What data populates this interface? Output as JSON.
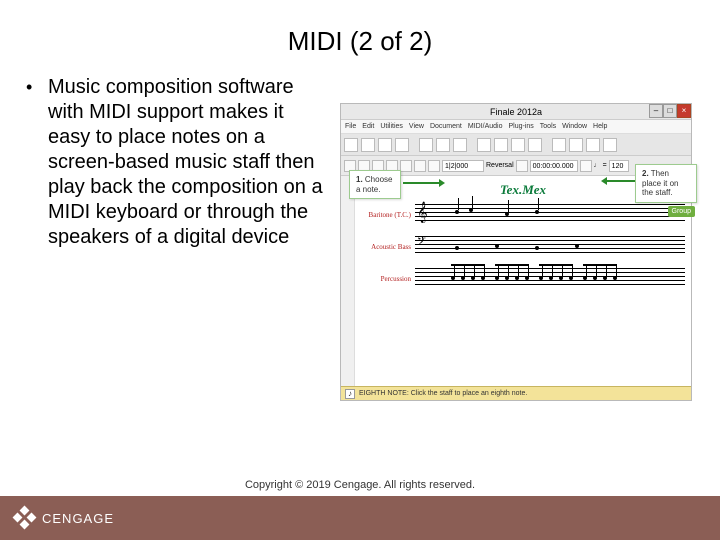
{
  "title": "MIDI (2 of 2)",
  "bullet": "Music composition software with MIDI support makes it easy to place notes on a screen-based music staff then play back the composition on a MIDI keyboard or through the speakers of a digital device",
  "app": {
    "window_title": "Finale 2012a",
    "menus": [
      "File",
      "Edit",
      "Utilities",
      "View",
      "Document",
      "MIDI/Audio",
      "Plug-ins",
      "Tools",
      "Window",
      "Help"
    ],
    "toolbar2": {
      "field1": "1|2|000",
      "label_rev": "Reversal",
      "bpm": "120"
    },
    "score_title": "Tex.Mex",
    "instruments": [
      "Baritone (T.C.)",
      "Acoustic Bass",
      "Percussion"
    ],
    "status": "EIGHTH NOTE: Click the staff to place an eighth note."
  },
  "callouts": {
    "c1_num": "1.",
    "c1_text": "Choose a note.",
    "c2_num": "2.",
    "c2_text": "Then place it on the staff."
  },
  "green_tab": "Group",
  "brand": "CENGAGE",
  "copyright": "Copyright © 2019 Cengage. All rights reserved."
}
